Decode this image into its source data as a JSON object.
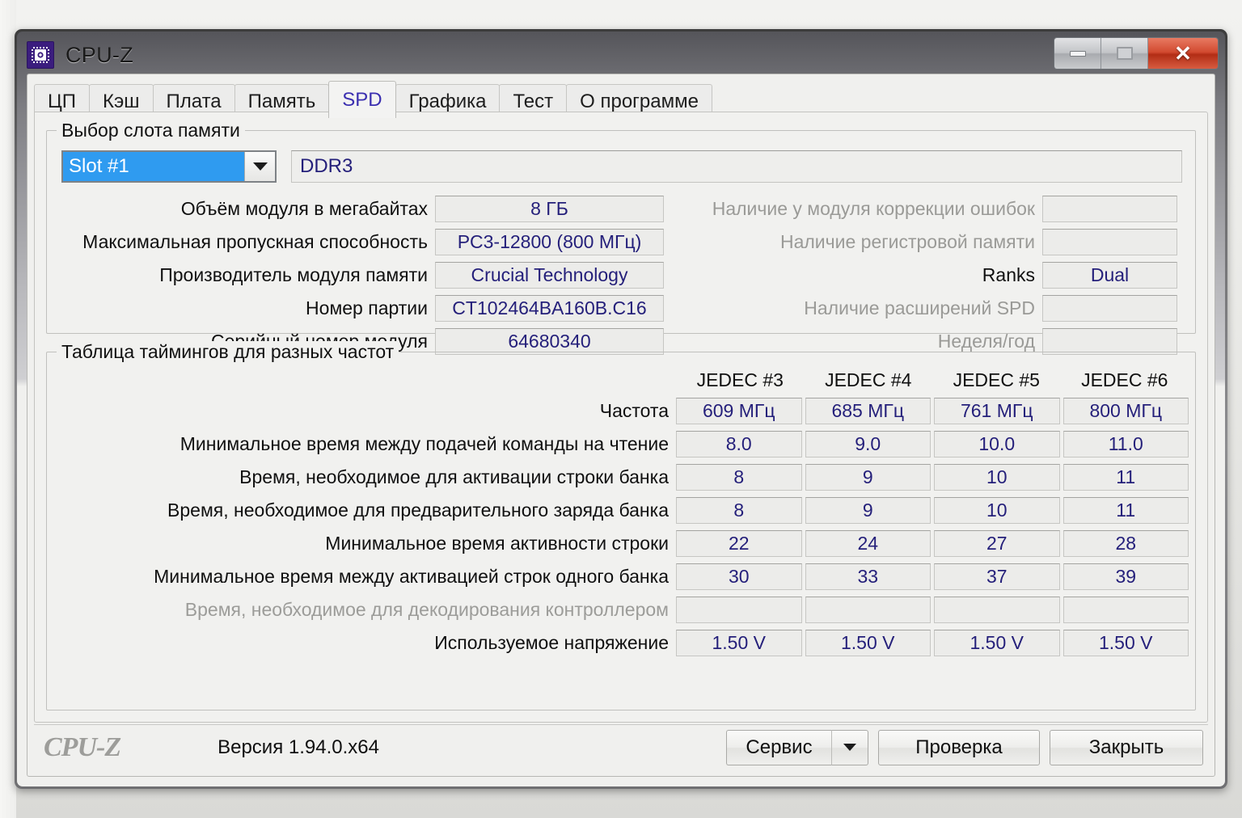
{
  "window": {
    "title": "CPU-Z",
    "icon": "cpu-chip-icon",
    "controls": {
      "minimize": "minimize-icon",
      "maximize": "maximize-icon",
      "close": "close-icon"
    }
  },
  "tabs": [
    {
      "label": "ЦП",
      "active": false
    },
    {
      "label": "Кэш",
      "active": false
    },
    {
      "label": "Плата",
      "active": false
    },
    {
      "label": "Память",
      "active": false
    },
    {
      "label": "SPD",
      "active": true
    },
    {
      "label": "Графика",
      "active": false
    },
    {
      "label": "Тест",
      "active": false
    },
    {
      "label": "О программе",
      "active": false
    }
  ],
  "slot_group": {
    "legend": "Выбор слота памяти",
    "slot_selected": "Slot #1",
    "memory_type": "DDR3",
    "left_rows": [
      {
        "label": "Объём модуля в мегабайтах",
        "value": "8 ГБ",
        "dim": false
      },
      {
        "label": "Максимальная пропускная способность",
        "value": "PC3-12800 (800 МГц)",
        "dim": false
      },
      {
        "label": "Производитель модуля памяти",
        "value": "Crucial Technology",
        "dim": false
      },
      {
        "label": "Номер партии",
        "value": "CT102464BA160B.C16",
        "dim": false
      },
      {
        "label": "Серийный номер модуля",
        "value": "64680340",
        "dim": false
      }
    ],
    "right_rows": [
      {
        "label": "Наличие у модуля коррекции ошибок",
        "value": "",
        "dim": true
      },
      {
        "label": "Наличие регистровой памяти",
        "value": "",
        "dim": true
      },
      {
        "label": "Ranks",
        "value": "Dual",
        "dim": false
      },
      {
        "label": "Наличие расширений SPD",
        "value": "",
        "dim": true
      },
      {
        "label": "Неделя/год",
        "value": "",
        "dim": true
      }
    ]
  },
  "timings_group": {
    "legend": "Таблица таймингов для разных частот",
    "columns": [
      "JEDEC #3",
      "JEDEC #4",
      "JEDEC #5",
      "JEDEC #6"
    ],
    "rows": [
      {
        "label": "Частота",
        "dim": false,
        "values": [
          "609 МГц",
          "685 МГц",
          "761 МГц",
          "800 МГц"
        ]
      },
      {
        "label": "Минимальное время между подачей команды на чтение",
        "dim": false,
        "values": [
          "8.0",
          "9.0",
          "10.0",
          "11.0"
        ]
      },
      {
        "label": "Время, необходимое для активации строки банка",
        "dim": false,
        "values": [
          "8",
          "9",
          "10",
          "11"
        ]
      },
      {
        "label": "Время, необходимое для предварительного заряда банка",
        "dim": false,
        "values": [
          "8",
          "9",
          "10",
          "11"
        ]
      },
      {
        "label": "Минимальное время активности строки",
        "dim": false,
        "values": [
          "22",
          "24",
          "27",
          "28"
        ]
      },
      {
        "label": "Минимальное время между активацией строк одного банка",
        "dim": false,
        "values": [
          "30",
          "33",
          "37",
          "39"
        ]
      },
      {
        "label": "Время, необходимое для декодирования контроллером",
        "dim": true,
        "values": [
          "",
          "",
          "",
          ""
        ]
      },
      {
        "label": "Используемое напряжение",
        "dim": false,
        "values": [
          "1.50 V",
          "1.50 V",
          "1.50 V",
          "1.50 V"
        ]
      }
    ]
  },
  "footer": {
    "brand": "CPU-Z",
    "version": "Версия 1.94.0.x64",
    "buttons": {
      "tools": "Сервис",
      "tools_dropdown": "chevron-down-icon",
      "validate": "Проверка",
      "close": "Закрыть"
    }
  },
  "colors": {
    "accent_value_text": "#241f7a",
    "active_tab_text": "#3b2fb0",
    "selection_blue": "#2f9bf0",
    "close_red": "#d24a30",
    "disabled_label": "#9a9a97"
  }
}
